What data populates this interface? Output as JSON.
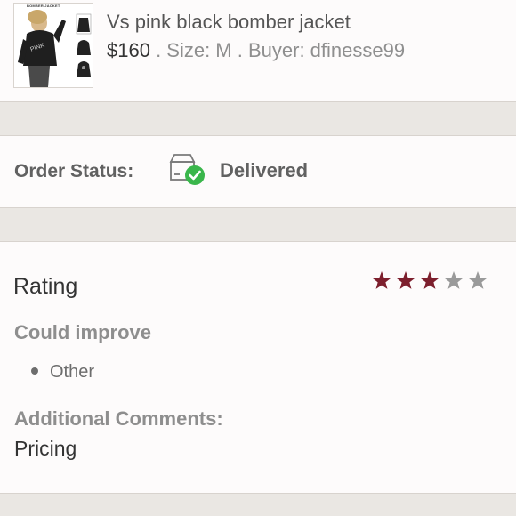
{
  "product": {
    "title": "Vs pink black bomber jacket",
    "price": "$160",
    "meta": " . Size: M . Buyer: dfinesse99",
    "thumbnail_caption": "BOMBER JACKET",
    "thumbnail_icon": "jacket-photo"
  },
  "order": {
    "status_label": "Order Status:",
    "status_value": "Delivered",
    "status_icon": "package-delivered-icon",
    "status_color": "#3ab64b"
  },
  "rating": {
    "label": "Rating",
    "stars": 3,
    "max_stars": 5,
    "filled_color": "#7d1f2d",
    "empty_color": "#9a9a9a",
    "improve_label": "Could improve",
    "reasons": [
      "Other"
    ],
    "comments_label": "Additional Comments:",
    "comments_value": "Pricing"
  }
}
